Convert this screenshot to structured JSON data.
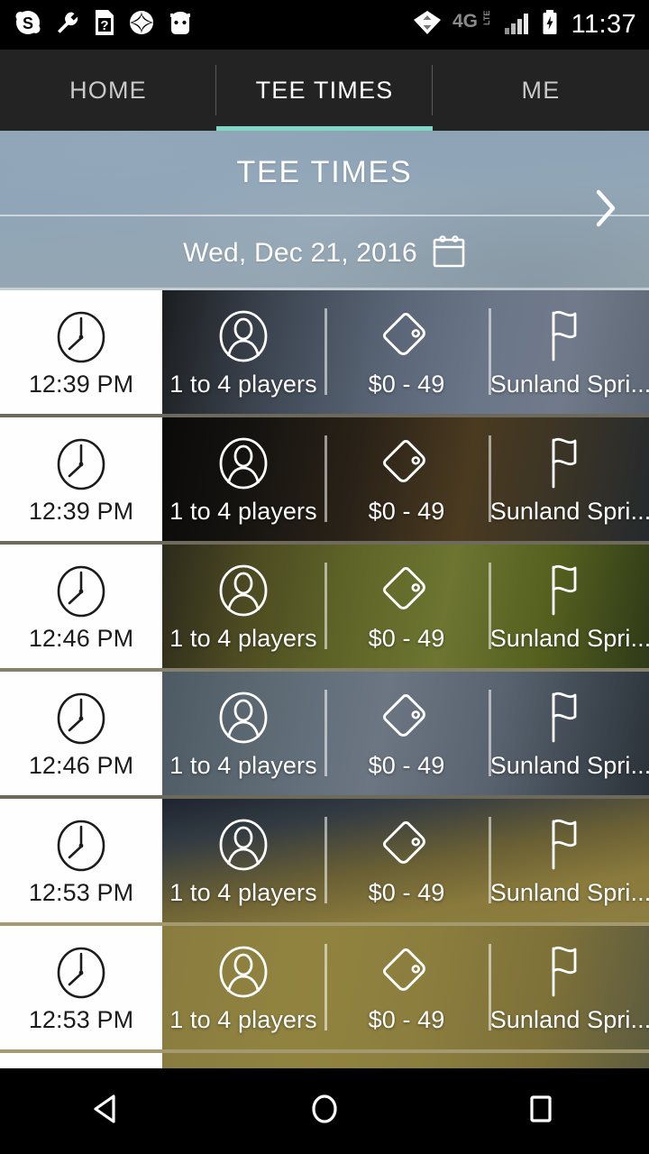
{
  "status_bar": {
    "time": "11:37",
    "network_label": "4G",
    "network_sub": "LTE",
    "left_icons": [
      {
        "name": "skype-icon",
        "glyph": "S"
      },
      {
        "name": "wrench-icon",
        "glyph": "wrench"
      },
      {
        "name": "sim-question-icon",
        "glyph": "?"
      },
      {
        "name": "starburst-icon",
        "glyph": "burst"
      },
      {
        "name": "cyanogenmod-robot-icon",
        "glyph": "robot"
      }
    ],
    "right_icons": [
      {
        "name": "data-transfer-icon"
      },
      {
        "name": "signal-bars-icon"
      },
      {
        "name": "battery-charging-icon"
      }
    ]
  },
  "tabs": {
    "items": [
      {
        "label": "HOME",
        "active": false,
        "name": "tab-home"
      },
      {
        "label": "TEE TIMES",
        "active": true,
        "name": "tab-tee-times"
      },
      {
        "label": "ME",
        "active": false,
        "name": "tab-me"
      }
    ],
    "active_accent": "#7fd7c4"
  },
  "header": {
    "title": "TEE TIMES",
    "date": "Wed, Dec 21, 2016",
    "calendar_icon": "calendar-icon",
    "next_icon": "chevron-right-icon"
  },
  "list": {
    "column_icons": {
      "time": "clock-icon",
      "players": "person-icon",
      "price": "price-tag-icon",
      "course": "golf-flag-icon"
    },
    "rows": [
      {
        "time": "12:39 PM",
        "players": "1 to 4 players",
        "price": "$0 - 49",
        "course": "Sunland Spri...",
        "bg": "bluegray-a"
      },
      {
        "time": "12:39 PM",
        "players": "1 to 4 players",
        "price": "$0 - 49",
        "course": "Sunland Spri...",
        "bg": "dark-brown"
      },
      {
        "time": "12:46 PM",
        "players": "1 to 4 players",
        "price": "$0 - 49",
        "course": "Sunland Spri...",
        "bg": "green-olive"
      },
      {
        "time": "12:46 PM",
        "players": "1 to 4 players",
        "price": "$0 - 49",
        "course": "Sunland Spri...",
        "bg": "bluegray-b"
      },
      {
        "time": "12:53 PM",
        "players": "1 to 4 players",
        "price": "$0 - 49",
        "course": "Sunland Spri...",
        "bg": "blue-gold"
      },
      {
        "time": "12:53 PM",
        "players": "1 to 4 players",
        "price": "$0 - 49",
        "course": "Sunland Spri...",
        "bg": "gold"
      }
    ]
  },
  "nav_bar": {
    "buttons": [
      {
        "name": "nav-back-button",
        "icon": "triangle-back-icon"
      },
      {
        "name": "nav-home-button",
        "icon": "circle-home-icon"
      },
      {
        "name": "nav-recents-button",
        "icon": "square-recents-icon"
      }
    ]
  }
}
